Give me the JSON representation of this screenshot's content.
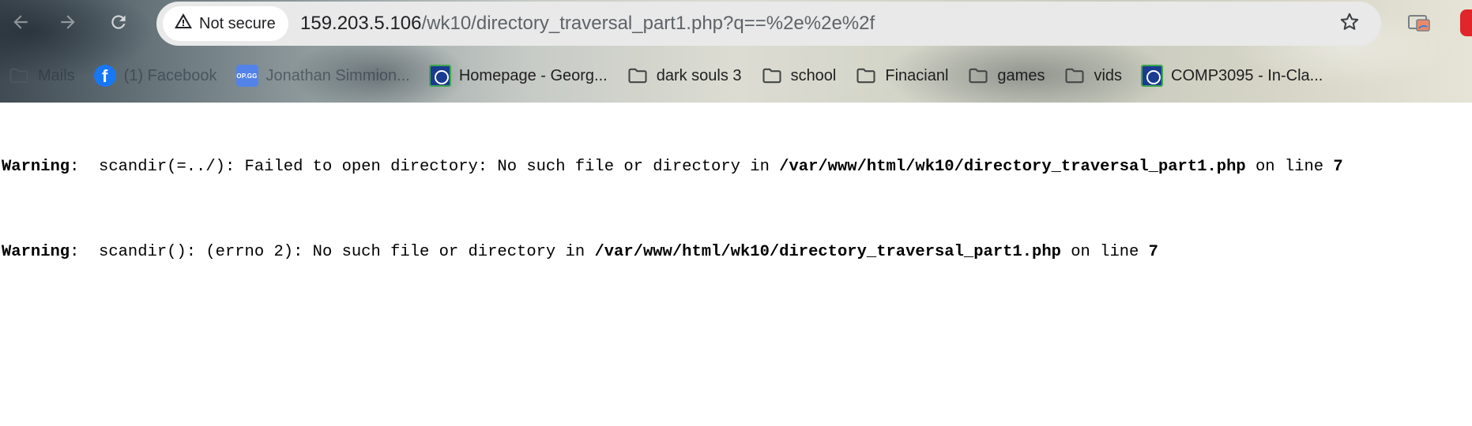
{
  "browser": {
    "security_label": "Not secure",
    "url_host": "159.203.5.106",
    "url_path": "/wk10/directory_traversal_part1.php?q==%2e%2e%2f",
    "nav_icons": [
      "back-arrow-icon",
      "forward-arrow-icon",
      "reload-icon"
    ],
    "bookmarks": [
      {
        "label": "Mails",
        "icon": "folder-icon"
      },
      {
        "label": "(1) Facebook",
        "icon": "facebook-icon"
      },
      {
        "label": "Jonathan Simmion...",
        "icon": "opgg-icon",
        "icon_text": "OP.GG"
      },
      {
        "label": "Homepage - Georg...",
        "icon": "george-brown-icon"
      },
      {
        "label": "dark souls 3",
        "icon": "folder-icon"
      },
      {
        "label": "school",
        "icon": "folder-icon"
      },
      {
        "label": "Finacianl",
        "icon": "folder-icon"
      },
      {
        "label": "games",
        "icon": "folder-icon"
      },
      {
        "label": "vids",
        "icon": "folder-icon"
      },
      {
        "label": "COMP3095 - In-Cla...",
        "icon": "george-brown-icon"
      }
    ]
  },
  "page": {
    "warnings": [
      {
        "label": "Warning",
        "separator": ":  ",
        "message": "scandir(=../): Failed to open directory: No such file or directory in ",
        "file": "/var/www/html/wk10/directory_traversal_part1.php",
        "line_text": " on line ",
        "line": "7"
      },
      {
        "label": "Warning",
        "separator": ":  ",
        "message": "scandir(): (errno 2): No such file or directory in ",
        "file": "/var/www/html/wk10/directory_traversal_part1.php",
        "line_text": " on line ",
        "line": "7"
      }
    ]
  }
}
